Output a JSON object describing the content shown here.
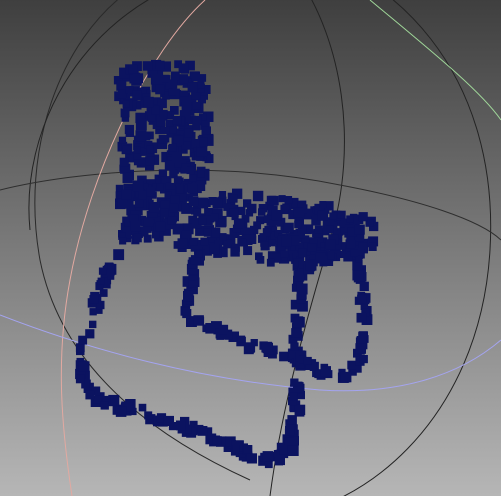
{
  "viewer": {
    "background": {
      "top": "#3f3f3f",
      "bottom": "#b6b6b6"
    },
    "point_color": "#0b1360",
    "point_style": "square",
    "gizmo": {
      "rings": [
        {
          "name": "meridian",
          "color": "#232323"
        },
        {
          "name": "meridian-left",
          "color": "#2a2a2a"
        },
        {
          "name": "equator",
          "color": "#2e2e2e"
        },
        {
          "name": "x-axis-ring",
          "color": "#e2a9a1"
        },
        {
          "name": "y-axis-ring",
          "color": "#9fd699"
        },
        {
          "name": "z-axis-ring",
          "color": "#a4a4f0"
        }
      ]
    },
    "object": "chair-point-cloud"
  }
}
